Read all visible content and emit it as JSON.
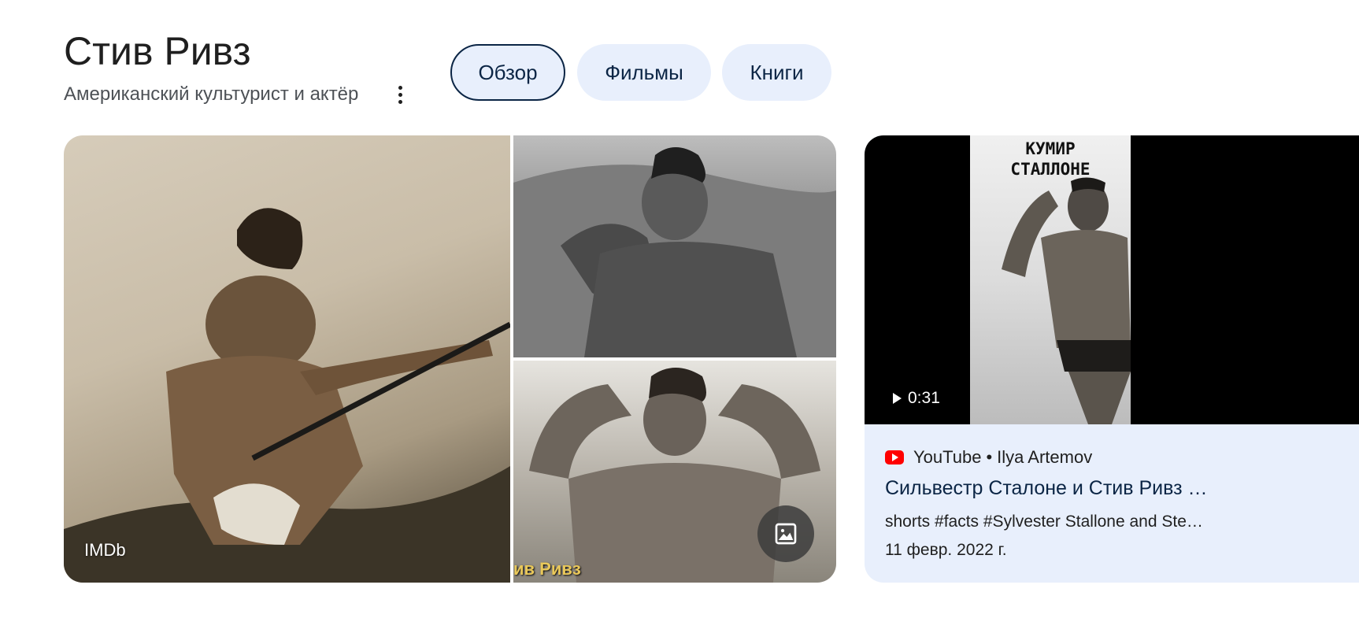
{
  "header": {
    "title": "Стив Ривз",
    "subtitle": "Американский культурист и актёр"
  },
  "tabs": [
    {
      "label": "Обзор",
      "active": true
    },
    {
      "label": "Фильмы",
      "active": false
    },
    {
      "label": "Книги",
      "active": false
    }
  ],
  "gallery": {
    "main_source": "IMDb",
    "bottom_overlay_text": "ив Ривз",
    "images_button_icon": "image-icon"
  },
  "video": {
    "duration": "0:31",
    "thumbnail_caption_line1": "КУМИР",
    "thumbnail_caption_line2": "СТАЛЛОНЕ",
    "platform": "YouTube",
    "separator": "•",
    "channel": "Ilya Artemov",
    "title": "Сильвестр Сталоне и Стив Ривз …",
    "description": "shorts #facts #Sylvester Stallone and Ste…",
    "date": "11 февр. 2022 г."
  },
  "colors": {
    "chip_bg": "#e8effc",
    "chip_text": "#0b2545",
    "youtube_red": "#ff0000"
  }
}
